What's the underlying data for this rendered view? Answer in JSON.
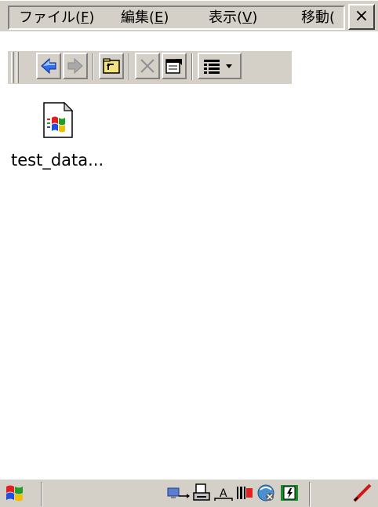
{
  "menubar": {
    "items": [
      {
        "label": "ファイル(",
        "accel": "F",
        "suffix": ")"
      },
      {
        "label": "編集(",
        "accel": "E",
        "suffix": ")"
      },
      {
        "label": "表示(",
        "accel": "V",
        "suffix": ")"
      },
      {
        "label": "移動(",
        "accel": "",
        "suffix": ""
      }
    ],
    "close_label": "×"
  },
  "toolbar": {
    "buttons": [
      "back-icon",
      "forward-icon",
      "up-folder-icon",
      "delete-icon",
      "properties-icon",
      "view-details-icon"
    ]
  },
  "files": [
    {
      "name": "test_data...",
      "icon": "windows-document-icon"
    }
  ],
  "taskbar": {
    "start_icon": "windows-start-icon",
    "tray_icons": [
      "network-icon",
      "printer-keyboard-icon",
      "input-method-icon",
      "barcode-icon",
      "wireless-disconnected-icon",
      "battery-charging-icon",
      "pen-input-icon"
    ]
  }
}
